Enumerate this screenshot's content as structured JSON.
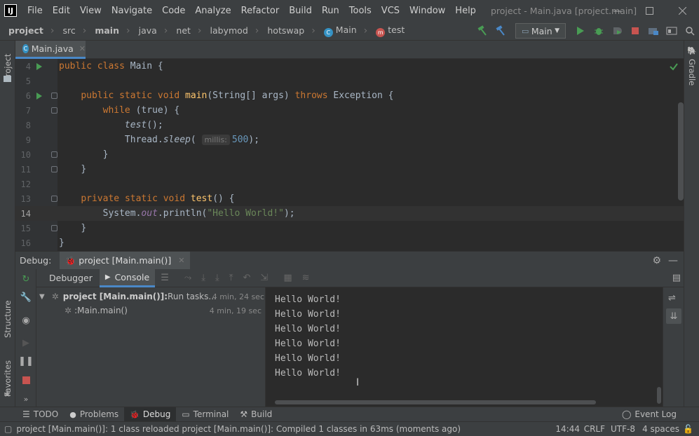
{
  "menubar": {
    "logo": "IJ",
    "items": [
      "File",
      "Edit",
      "View",
      "Navigate",
      "Code",
      "Analyze",
      "Refactor",
      "Build",
      "Run",
      "Tools",
      "VCS",
      "Window",
      "Help"
    ],
    "window_title": "project - Main.java [project.main]"
  },
  "breadcrumb": [
    "project",
    "src",
    "main",
    "java",
    "net",
    "labymod",
    "hotswap",
    "Main",
    "test"
  ],
  "run_config": "Main",
  "editor_tab": "Main.java",
  "left_tools": {
    "project": "Project",
    "structure": "Structure",
    "favorites": "Favorites"
  },
  "right_tools": {
    "gradle": "Gradle"
  },
  "code_lines": [
    {
      "num": "4"
    },
    {
      "num": "5"
    },
    {
      "num": "6"
    },
    {
      "num": "7"
    },
    {
      "num": "8"
    },
    {
      "num": "9"
    },
    {
      "num": "10"
    },
    {
      "num": "11"
    },
    {
      "num": "12"
    },
    {
      "num": "13"
    },
    {
      "num": "14"
    },
    {
      "num": "15"
    },
    {
      "num": "16"
    }
  ],
  "code_tokens": {
    "public": "public",
    "class": "class",
    "Main": "Main",
    "brace_open": "{",
    "brace_close": "}",
    "static": "static",
    "void": "void",
    "main": "main",
    "main_args": "(String[] args)",
    "throws": "throws",
    "Exception": "Exception",
    "while": "while",
    "true_expr": "(true)",
    "test_call": "test",
    "paren_semi": "();",
    "Thread": "Thread.",
    "sleep": "sleep",
    "sleep_open": "(",
    "hint": "millis:",
    "sleep_val": "500",
    "sleep_close": ");",
    "private": "private",
    "test_decl": "test",
    "test_params": "()",
    "System": "System.",
    "out": "out",
    "println_open": ".println(",
    "hello_str": "\"Hello World!\"",
    "println_close": ");"
  },
  "debug": {
    "label": "Debug:",
    "session": "project [Main.main()]",
    "tabs": {
      "debugger": "Debugger",
      "console": "Console"
    },
    "threads": [
      {
        "name": "project [Main.main()]:",
        "suffix": " Run tasks...",
        "time": "4 min, 24 sec"
      },
      {
        "name": ":Main.main()",
        "suffix": "",
        "time": "4 min, 19 sec"
      }
    ],
    "console_lines": [
      "Hello World!",
      "Hello World!",
      "Hello World!",
      "Hello World!",
      "Hello World!",
      "Hello World!"
    ]
  },
  "bottom_tabs": [
    "TODO",
    "Problems",
    "Debug",
    "Terminal",
    "Build"
  ],
  "event_log": "Event Log",
  "status": {
    "message": "project [Main.main()]: 1 class reloaded project [Main.main()]: Compiled 1 classes in 63ms (moments ago)",
    "position": "14:44",
    "line_sep": "CRLF",
    "encoding": "UTF-8",
    "indent": "4 spaces"
  },
  "colors": {
    "keyword": "#cc7832",
    "function": "#ffc66d",
    "string": "#6a8759",
    "number": "#6897bb",
    "field": "#9876aa",
    "run": "#499c54",
    "stop": "#c75450"
  }
}
